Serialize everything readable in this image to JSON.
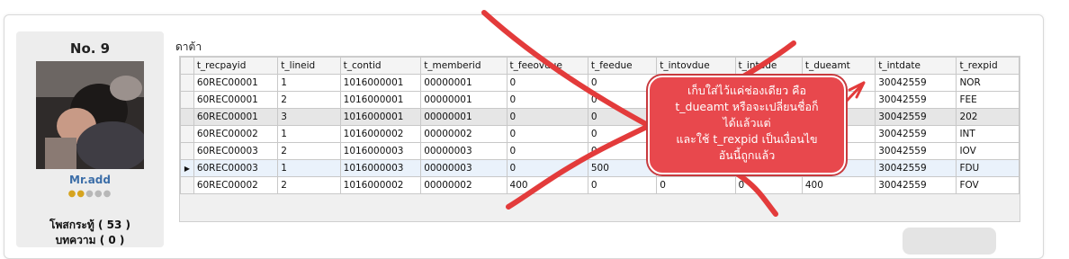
{
  "post": {
    "number": "No. 9",
    "username": "Mr.add",
    "rank_filled": 2,
    "rank_total": 5,
    "post_count_label": "โพสกระทู้ ( 53 )",
    "extra_line": "บทความ ( 0 )"
  },
  "caption": "ดาต้า",
  "grid": {
    "columns": [
      "t_recpayid",
      "t_lineid",
      "t_contid",
      "t_memberid",
      "t_feeovdue",
      "t_feedue",
      "t_intovdue",
      "t_intdue",
      "t_dueamt",
      "t_intdate",
      "t_rexpid"
    ],
    "rows": [
      [
        "60REC00001",
        "1",
        "1016000001",
        "00000001",
        "0",
        "0",
        "",
        "",
        "",
        "30042559",
        "NOR"
      ],
      [
        "60REC00001",
        "2",
        "1016000001",
        "00000001",
        "0",
        "0",
        "",
        "",
        "",
        "30042559",
        "FEE"
      ],
      [
        "60REC00001",
        "3",
        "1016000001",
        "00000001",
        "0",
        "0",
        "",
        "",
        "",
        "30042559",
        "202"
      ],
      [
        "60REC00002",
        "1",
        "1016000002",
        "00000002",
        "0",
        "0",
        "",
        "",
        "",
        "30042559",
        "INT"
      ],
      [
        "60REC00003",
        "2",
        "1016000003",
        "00000003",
        "0",
        "0",
        "",
        "",
        "",
        "30042559",
        "IOV"
      ],
      [
        "60REC00003",
        "1",
        "1016000003",
        "00000003",
        "0",
        "500",
        "",
        "",
        "",
        "30042559",
        "FDU"
      ],
      [
        "60REC00002",
        "2",
        "1016000002",
        "00000002",
        "400",
        "0",
        "0",
        "0",
        "400",
        "30042559",
        "FOV"
      ]
    ],
    "current_row_marker": "▶"
  },
  "callout": {
    "lines": [
      "เก็บใส่ไว้แค่ช่องเดียว คือ",
      "t_dueamt หรือจะเปลี่ยนชื่อก็",
      "ได้แล้วแต่",
      "และใช้ t_rexpid เป็นเงื่อนไข",
      "อันนี้ถูกแล้ว"
    ]
  },
  "colors": {
    "annotation_red": "#e8484d",
    "username_blue": "#3c6ea8",
    "panel_gray": "#ededed"
  }
}
